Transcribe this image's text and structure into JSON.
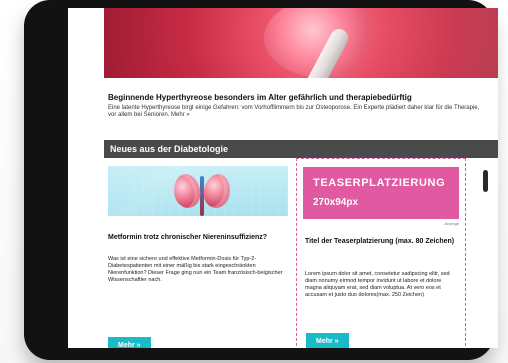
{
  "hero": {
    "image_alt": "Schilddrüse (Hyperthyreose) Illustration"
  },
  "article": {
    "title": "Beginnende Hyperthyreose besonders im Alter gefährlich und therapiebedürftig",
    "teaser": "Eine latente Hyperthyreose birgt einige Gefahren: vom Vorhofflimmern bis zur Osteoporose. Ein Experte plädiert daher klar für die Therapie, vor allem bei Senioren.",
    "more_label": "Mehr »"
  },
  "section": {
    "title": "Neues aus der Diabetologie"
  },
  "left_card": {
    "image_alt": "Nieren Illustration",
    "title": "Metformin trotz chronischer Niereninsuffizienz?",
    "text": "Was ist eine sichere und effektive Metformin-Dosis für Typ-2-Diabetespatienten mit einer mäßig bis stark eingeschränkten Nierenfunktion? Dieser Frage ging nun ein Team französisch-belgischer Wissenschaftler nach.",
    "button_label": "Mehr »"
  },
  "right_card": {
    "teaser_line1": "TEASERPLATZIERUNG",
    "teaser_line2": "270x94px",
    "ad_label": "Anzeige",
    "title": "Titel der Teaserplatzierung (max. 80 Zeichen)",
    "text": "Lorem ipsum dolor sit amet, consetetur sadipscing elitr, sed diam nonumy eirmod tempor invidunt ut labore et dolore magna aliquyam erat, sed diam voluptua. At vero eos et accusam et justo duo dolores(max. 250 Zeichen)",
    "button_label": "Mehr »",
    "accent": "#e059a1"
  },
  "colors": {
    "section_bar": "#4a4a4a",
    "button": "#1bbac7",
    "dashed_border": "#e45aa3",
    "device": "#121212"
  },
  "icons": {
    "device": "tablet-device-icon"
  }
}
